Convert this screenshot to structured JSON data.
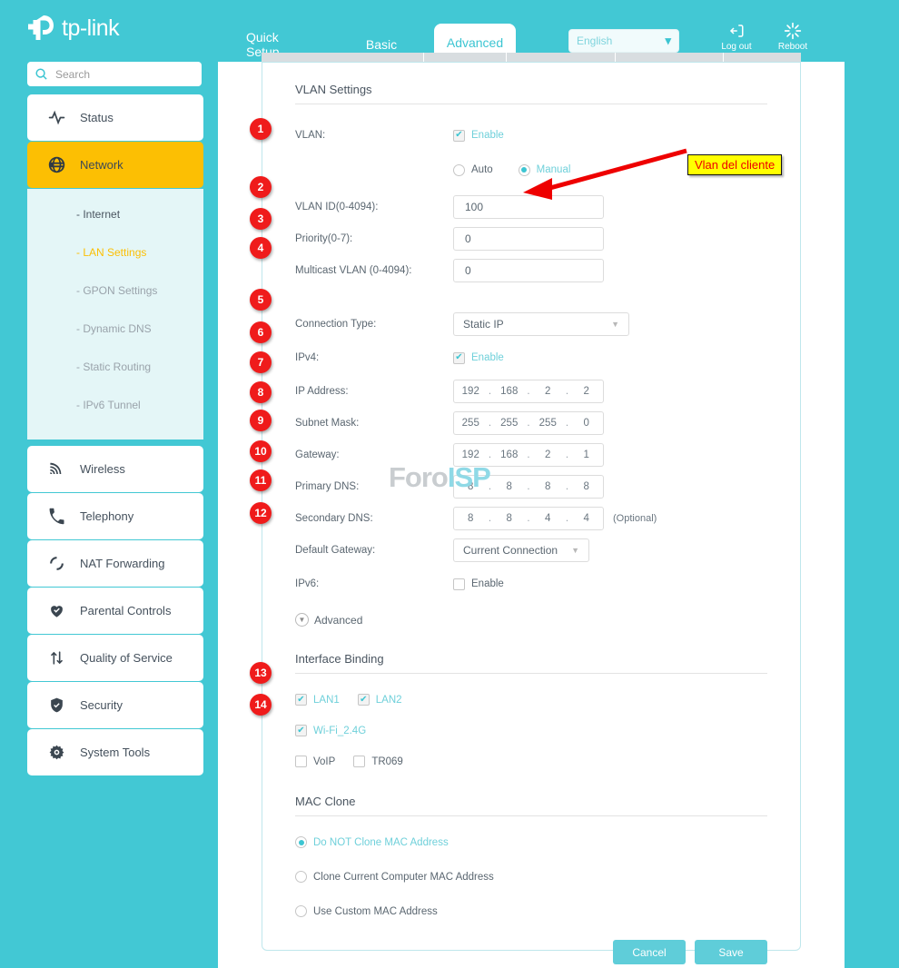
{
  "brand": {
    "name": "tp-link"
  },
  "header": {
    "tabs": [
      {
        "label": "Quick Setup",
        "active": false
      },
      {
        "label": "Basic",
        "active": false
      },
      {
        "label": "Advanced",
        "active": true
      }
    ],
    "language": {
      "selected": "English",
      "chevron": "chevron-down-icon"
    },
    "actions": [
      {
        "label": "Log out",
        "icon": "logout-icon"
      },
      {
        "label": "Reboot",
        "icon": "reboot-icon"
      }
    ]
  },
  "search": {
    "placeholder": "Search",
    "value": "",
    "icon": "search-icon"
  },
  "sidebar": {
    "items": [
      {
        "label": "Status",
        "icon": "activity-icon",
        "active": false
      },
      {
        "label": "Network",
        "icon": "globe-icon",
        "active": true
      },
      {
        "label": "Wireless",
        "icon": "wifi-icon",
        "active": false
      },
      {
        "label": "Telephony",
        "icon": "phone-icon",
        "active": false
      },
      {
        "label": "NAT Forwarding",
        "icon": "nat-icon",
        "active": false
      },
      {
        "label": "Parental Controls",
        "icon": "heart-icon",
        "active": false
      },
      {
        "label": "Quality of Service",
        "icon": "arrows-icon",
        "active": false
      },
      {
        "label": "Security",
        "icon": "shield-icon",
        "active": false
      },
      {
        "label": "System Tools",
        "icon": "gear-icon",
        "active": false
      }
    ],
    "submenu": [
      {
        "label": "- Internet",
        "state": "plain"
      },
      {
        "label": "- LAN Settings",
        "state": "current"
      },
      {
        "label": "- GPON Settings",
        "state": "muted"
      },
      {
        "label": "- Dynamic DNS",
        "state": "muted"
      },
      {
        "label": "- Static Routing",
        "state": "muted"
      },
      {
        "label": "- IPv6 Tunnel",
        "state": "muted"
      }
    ]
  },
  "vlan_section": {
    "title": "VLAN Settings",
    "vlan_label": "VLAN:",
    "vlan_enable_label": "Enable",
    "vlan_enable_checked": true,
    "mode_auto_label": "Auto",
    "mode_manual_label": "Manual",
    "mode_selected": "Manual",
    "vlan_id_label": "VLAN ID(0-4094):",
    "vlan_id_value": "100",
    "priority_label": "Priority(0-7):",
    "priority_value": "0",
    "multicast_label": "Multicast VLAN (0-4094):",
    "multicast_value": "0"
  },
  "connection_section": {
    "connection_type_label": "Connection Type:",
    "connection_type_value": "Static IP",
    "ipv4_label": "IPv4:",
    "ipv4_enable_label": "Enable",
    "ipv4_enable_checked": true,
    "ip_address_label": "IP Address:",
    "ip_address_value": [
      "192",
      "168",
      "2",
      "2"
    ],
    "subnet_mask_label": "Subnet Mask:",
    "subnet_mask_value": [
      "255",
      "255",
      "255",
      "0"
    ],
    "gateway_label": "Gateway:",
    "gateway_value": [
      "192",
      "168",
      "2",
      "1"
    ],
    "primary_dns_label": "Primary DNS:",
    "primary_dns_value": [
      "8",
      "8",
      "8",
      "8"
    ],
    "secondary_dns_label": "Secondary DNS:",
    "secondary_dns_value": [
      "8",
      "8",
      "4",
      "4"
    ],
    "secondary_dns_note": "(Optional)",
    "default_gateway_label": "Default Gateway:",
    "default_gateway_value": "Current Connection",
    "ipv6_label": "IPv6:",
    "ipv6_enable_label": "Enable",
    "ipv6_enable_checked": false,
    "advanced_toggle_label": "Advanced"
  },
  "interface_binding": {
    "title": "Interface Binding",
    "row1": [
      {
        "label": "LAN1",
        "checked": true
      },
      {
        "label": "LAN2",
        "checked": true
      }
    ],
    "row2": [
      {
        "label": "Wi-Fi_2.4G",
        "checked": true
      }
    ],
    "row3": [
      {
        "label": "VoIP",
        "checked": false
      },
      {
        "label": "TR069",
        "checked": false
      }
    ]
  },
  "mac_clone": {
    "title": "MAC Clone",
    "options": [
      {
        "label": "Do NOT Clone MAC Address",
        "selected": true
      },
      {
        "label": "Clone Current Computer MAC Address",
        "selected": false
      },
      {
        "label": "Use Custom MAC Address",
        "selected": false
      }
    ]
  },
  "buttons": {
    "cancel": "Cancel",
    "save": "Save"
  },
  "watermark": {
    "part1": "Foro",
    "part2": "ISP"
  },
  "annotations": {
    "callout_text": "Vlan del cliente",
    "badges": [
      "1",
      "2",
      "3",
      "4",
      "5",
      "6",
      "7",
      "8",
      "9",
      "10",
      "11",
      "12",
      "13",
      "14"
    ]
  },
  "colors": {
    "teal": "#42c8d4",
    "accent_teal": "#3cc5d2",
    "highlight_yellow": "#fcbf03",
    "badge_red": "#ef1b1b",
    "callout_yellow": "#ffff00",
    "callout_text_red": "#ee0000"
  }
}
